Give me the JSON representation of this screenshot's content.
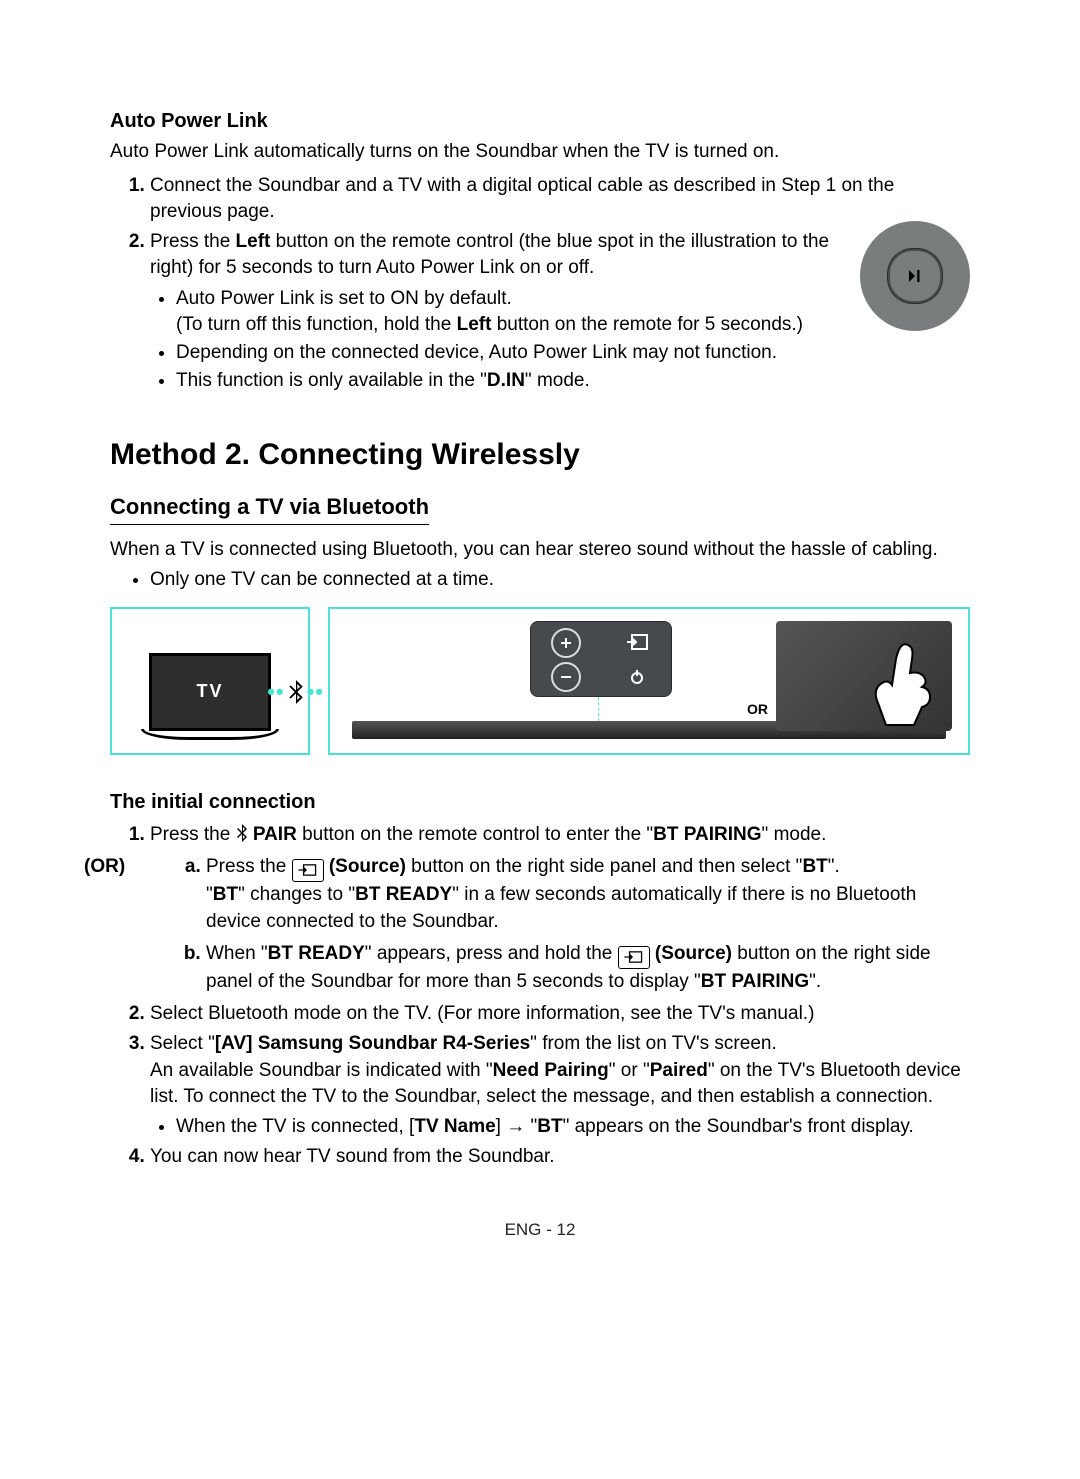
{
  "autoPowerLink": {
    "heading": "Auto Power Link",
    "intro": "Auto Power Link automatically turns on the Soundbar when the TV is turned on.",
    "step1": "Connect the Soundbar and a TV with a digital optical cable as described in Step 1 on the previous page.",
    "step2_pre": "Press the ",
    "step2_bold": "Left",
    "step2_post": " button on the remote control (the blue spot in the illustration to the right) for 5 seconds to turn Auto Power Link on or off.",
    "bullet_a_line1": "Auto Power Link is set to ON by default.",
    "bullet_a_line2_pre": "(To turn off this function, hold the ",
    "bullet_a_line2_bold": "Left",
    "bullet_a_line2_post": " button on the remote for 5 seconds.)",
    "bullet_b": "Depending on the connected device, Auto Power Link may not function.",
    "bullet_c_pre": "This function is only available in the \"",
    "bullet_c_bold": "D.IN",
    "bullet_c_post": "\" mode."
  },
  "method2": {
    "heading": "Method 2. Connecting Wirelessly",
    "subheading": "Connecting a TV via Bluetooth",
    "intro": "When a TV is connected using Bluetooth, you can hear stereo sound without the hassle of cabling.",
    "bullet1": "Only one TV can be connected at a time."
  },
  "figure": {
    "tvLabel": "TV",
    "orLabel": "OR"
  },
  "initial": {
    "heading": "The initial connection",
    "orLabel": "(OR)",
    "step1_pre": "Press the ",
    "step1_pair": " PAIR",
    "step1_mid": " button on the remote control to enter the \"",
    "step1_btpairing": "BT PAIRING",
    "step1_post": "\" mode.",
    "step_a_pre": "Press the ",
    "step_a_source": " (Source)",
    "step_a_mid": " button on the right side panel and then select \"",
    "step_a_bt": "BT",
    "step_a_post": "\".",
    "step_a_line2_pre": "\"",
    "step_a_line2_bt": "BT",
    "step_a_line2_mid": "\" changes to \"",
    "step_a_line2_btready": "BT READY",
    "step_a_line2_post": "\" in a few seconds automatically if there is no Bluetooth device connected to the Soundbar.",
    "step_b_pre": "When \"",
    "step_b_btready": "BT READY",
    "step_b_mid": "\" appears, press and hold the ",
    "step_b_source": " (Source)",
    "step_b_mid2": " button on the right side panel of the Soundbar for more than 5 seconds to display \"",
    "step_b_btpairing": "BT PAIRING",
    "step_b_post": "\".",
    "step2": "Select Bluetooth mode on the TV. (For more information, see the TV's manual.)",
    "step3_pre": "Select \"",
    "step3_bold": "[AV] Samsung Soundbar R4-Series",
    "step3_mid": "\" from the list on TV's screen.",
    "step3_line2_pre": "An available Soundbar is indicated with \"",
    "step3_line2_need": "Need Pairing",
    "step3_line2_mid": "\" or \"",
    "step3_line2_paired": "Paired",
    "step3_line2_post": "\" on the TV's Bluetooth device list. To connect the TV to the Soundbar, select the message, and then establish a connection.",
    "step3_bullet_pre": "When the TV is connected, [",
    "step3_bullet_tvname": "TV Name",
    "step3_bullet_mid": "] → \"",
    "step3_bullet_bt": "BT",
    "step3_bullet_post": "\" appears on the Soundbar's front display.",
    "step4": "You can now hear TV sound from the Soundbar."
  },
  "pageNumber": "ENG - 12"
}
